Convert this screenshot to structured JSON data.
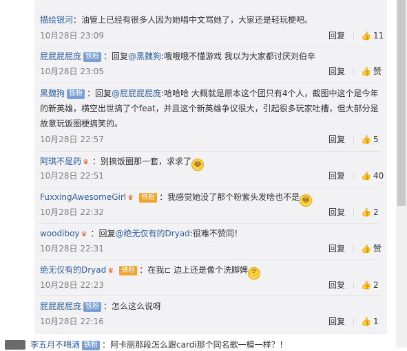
{
  "comments": [
    {
      "user": "描绘银河",
      "badge": "",
      "vip": false,
      "reply_prefix": "",
      "mention": "",
      "text": "：油管上已经有很多人因为她唱中文骂她了，大家还是轻玩梗吧。",
      "emoji": "",
      "time": "10月28日 23:09",
      "reply": "回复",
      "likes": "11"
    },
    {
      "user": "屁屁屁屁庞",
      "badge": "铁粉",
      "vip": false,
      "reply_prefix": "：回复",
      "mention": "@黑魏狗",
      "text": ":哦哦哦不懂游戏 我以为大家都讨厌刘伯辛",
      "emoji": "",
      "time": "10月28日 23:05",
      "reply": "回复",
      "likes": "赞"
    },
    {
      "user": "黑魏狗",
      "badge": "铁粉",
      "vip": false,
      "reply_prefix": "：回复",
      "mention": "@屁屁屁屁庞",
      "text": ":哈哈哈 大概就是原本这个团只有4个人，截图中这个是今年的新英雄，横空出世搞了个feat，并且这个新英雄争议很大，引起很多玩家吐槽，但大部分是故意玩饭圈梗搞笑的。",
      "emoji": "",
      "time": "10月28日 22:57",
      "reply": "回复",
      "likes": "5"
    },
    {
      "user": "阿琪不是药",
      "badge": "",
      "vip": true,
      "reply_prefix": "",
      "mention": "",
      "text": "：别搞饭圈那一套，求求了",
      "emoji": "😂",
      "time": "10月28日 22:51",
      "reply": "回复",
      "likes": "40"
    },
    {
      "user": "FuxxingAwesomeGirl",
      "badge": "铁粉",
      "vip": true,
      "reply_prefix": "",
      "mention": "",
      "text": "：我感觉她没了那个粉紫头发啥也不是",
      "emoji": "😂",
      "time": "10月28日 22:32",
      "reply": "回复",
      "likes": "2"
    },
    {
      "user": "woodiboy",
      "badge": "",
      "vip": true,
      "reply_prefix": "：回复",
      "mention": "@绝无仅有的Dryad",
      "text": ":很难不赞同！",
      "emoji": "",
      "time": "10月28日 22:31",
      "reply": "回复",
      "likes": "赞"
    },
    {
      "user": "绝无仅有的Dryad",
      "badge": "铁粉",
      "vip": true,
      "reply_prefix": "",
      "mention": "",
      "text": "：在我⊏ 边上还是像个洗脚婢",
      "emoji": "🤔",
      "time": "10月28日 22:23",
      "reply": "回复",
      "likes": "2"
    },
    {
      "user": "屁屁屁屁庞",
      "badge": "铁粉",
      "vip": false,
      "reply_prefix": "",
      "mention": "",
      "text": "：怎么这么说呀",
      "emoji": "",
      "time": "10月28日 22:16",
      "reply": "回复",
      "likes": "1"
    }
  ],
  "bottom": {
    "user": "李五月不喝酒",
    "badge": "铁粉",
    "text": "：阿卡丽那段怎么跟cardi那个同名歌一模一样？！"
  }
}
